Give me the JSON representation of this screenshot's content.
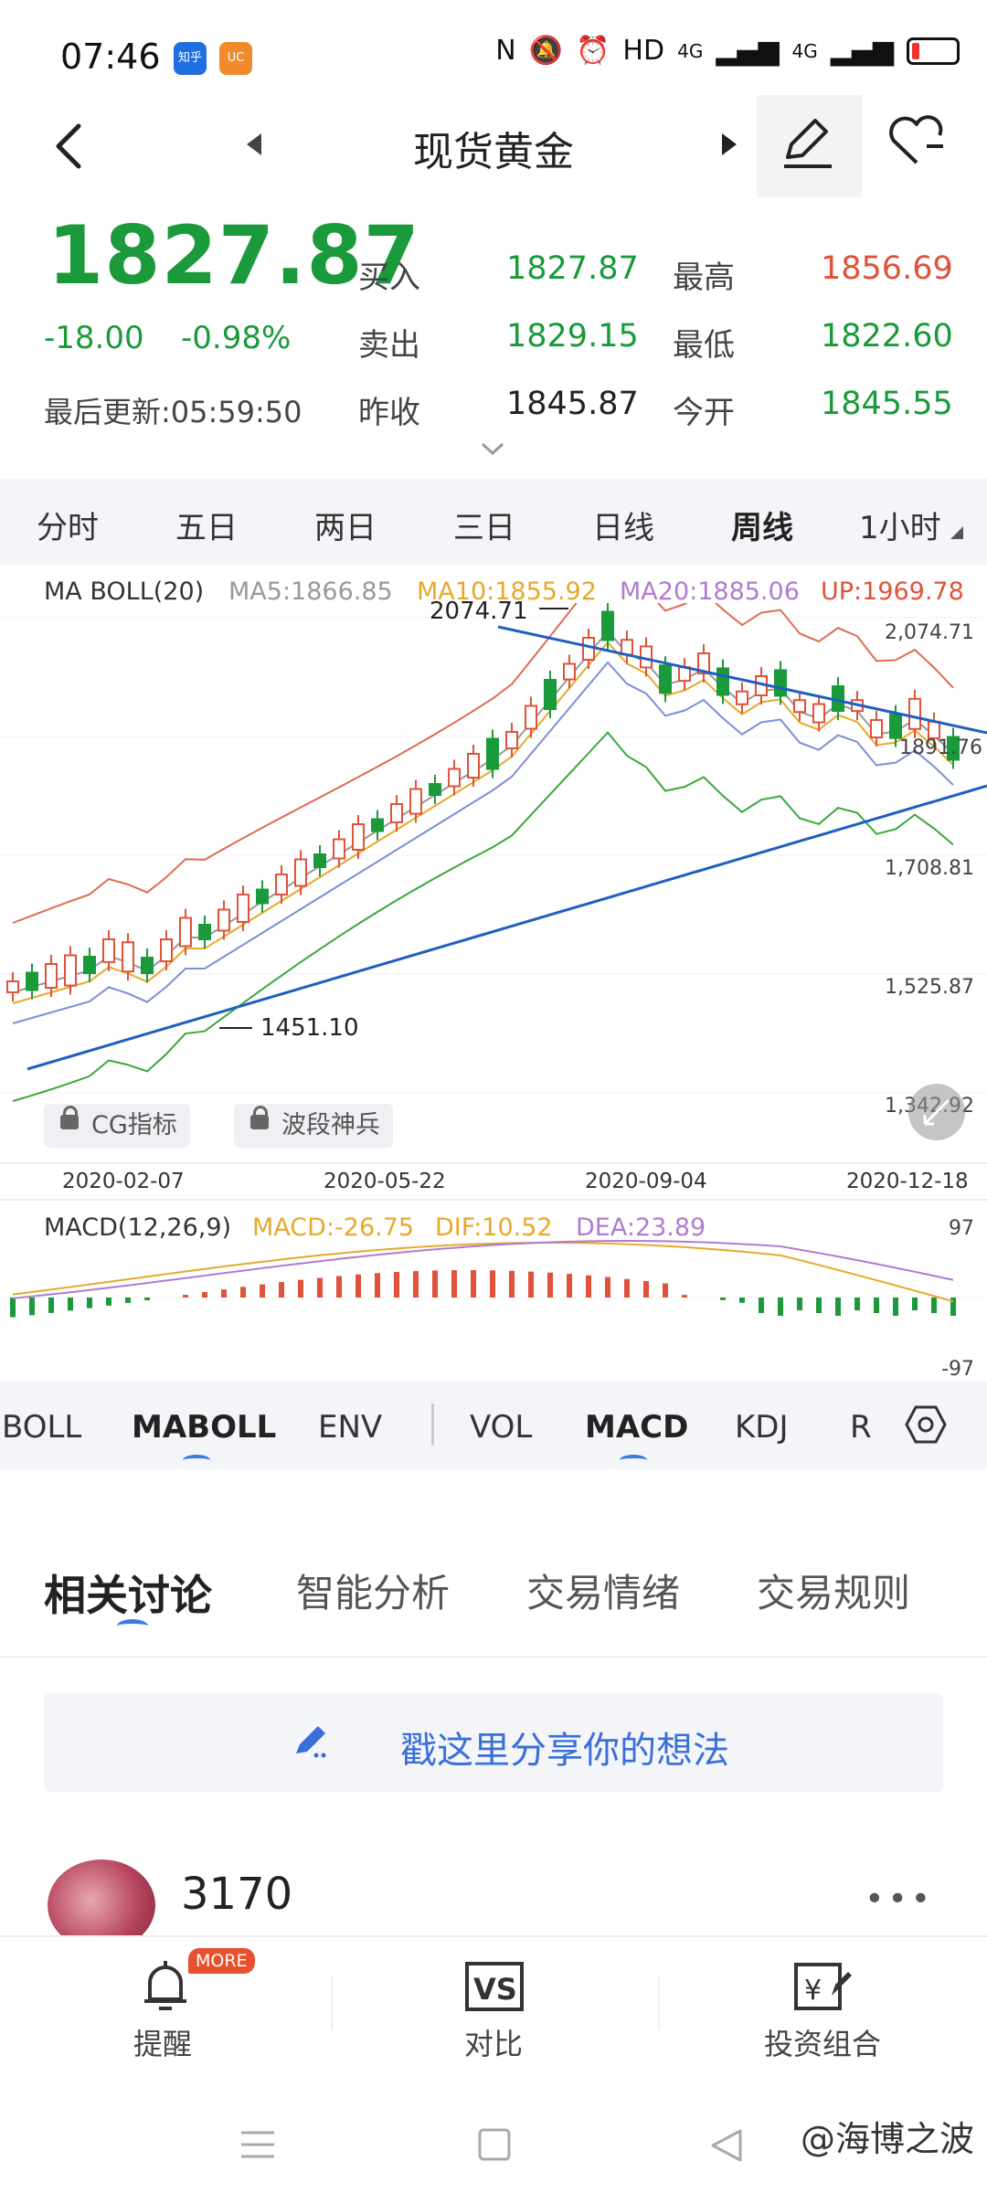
{
  "status": {
    "time": "07:46",
    "app1": "知乎",
    "app2": "UC",
    "right": "HD",
    "net1": "4G",
    "net2": "4G"
  },
  "header": {
    "title": "现货黄金"
  },
  "quote": {
    "price": "1827.87",
    "change": "-18.00",
    "change_pct": "-0.98%",
    "last_update": "最后更新:05:59:50",
    "buy_label": "买入",
    "buy_value": "1827.87",
    "sell_label": "卖出",
    "sell_value": "1829.15",
    "prev_close_label": "昨收",
    "prev_close_value": "1845.87",
    "high_label": "最高",
    "high_value": "1856.69",
    "low_label": "最低",
    "low_value": "1822.60",
    "open_label": "今开",
    "open_value": "1845.55"
  },
  "period_tabs": [
    "分时",
    "五日",
    "两日",
    "三日",
    "日线",
    "周线",
    "1小时"
  ],
  "active_period": "周线",
  "chart": {
    "legend": {
      "name": "MA BOLL(20)",
      "ma5": "MA5:1866.85",
      "ma10": "MA10:1855.92",
      "ma20": "MA20:1885.06",
      "up": "UP:1969.78"
    },
    "high_marker": "2074.71",
    "low_marker": "1451.10",
    "last_label": "1891.76",
    "y_labels": [
      "2,074.71",
      "1,708.81",
      "1,525.87",
      "1,342.92"
    ],
    "dates": [
      "2020-02-07",
      "2020-05-22",
      "2020-09-04",
      "2020-12-18"
    ],
    "locked_cg": "CG指标",
    "locked_wave": "波段神兵",
    "macd_legend": {
      "name": "MACD(12,26,9)",
      "macd": "MACD:-26.75",
      "dif": "DIF:10.52",
      "dea": "DEA:23.89"
    },
    "macd_top": "97",
    "macd_bottom": "-97",
    "colors": {
      "up": "#e0523a",
      "down": "#1a9a3a",
      "ma5": "#999999",
      "ma10": "#e6a92b",
      "ma20": "#7c8fd8",
      "upper": "#e06a50",
      "lower": "#3aa83a",
      "trend": "#1f5fbf"
    }
  },
  "chart_data": {
    "type": "line",
    "title": "",
    "ylim": [
      1342.92,
      2074.71
    ],
    "high": 2074.71,
    "low": 1451.1,
    "last": 1891.76,
    "x_labels": [
      "2020-02-07",
      "2020-05-22",
      "2020-09-04",
      "2020-12-18"
    ]
  },
  "indicator_tabs": [
    "BOLL",
    "MABOLL",
    "ENV",
    "VOL",
    "MACD",
    "KDJ",
    "R"
  ],
  "active_indicators": [
    "MABOLL",
    "MACD"
  ],
  "discussion_tabs": [
    "相关讨论",
    "智能分析",
    "交易情绪",
    "交易规则"
  ],
  "active_discussion": "相关讨论",
  "share_placeholder": "戳这里分享你的想法",
  "post": {
    "username": "3170"
  },
  "bottom_nav": {
    "alert": "提醒",
    "alert_badge": "MORE",
    "compare": "对比",
    "portfolio": "投资组合"
  },
  "watermark": "@海博之波"
}
